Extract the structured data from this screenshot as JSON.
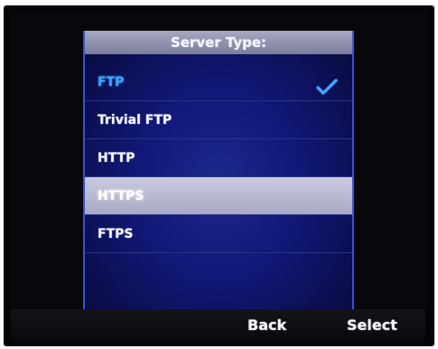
{
  "panel": {
    "title": "Server Type:"
  },
  "options": [
    {
      "label": "FTP",
      "state": "selected",
      "indicator": "check-icon"
    },
    {
      "label": "Trivial FTP",
      "state": "normal"
    },
    {
      "label": "HTTP",
      "state": "normal"
    },
    {
      "label": "HTTPS",
      "state": "highlighted"
    },
    {
      "label": "FTPS",
      "state": "normal"
    }
  ],
  "softkeys": {
    "back_label": "Back",
    "select_label": "Select"
  },
  "colors": {
    "selected_text": "#3ea6ff",
    "highlight_bg": "#b9b9d2",
    "panel_bg": "#12197a"
  }
}
